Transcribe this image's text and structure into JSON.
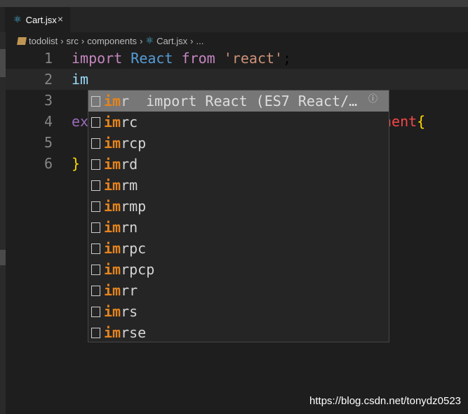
{
  "tab": {
    "label": "Cart.jsx",
    "close": "×",
    "icon": "react-icon"
  },
  "breadcrumb": [
    "todolist",
    "src",
    "components",
    "Cart.jsx",
    "..."
  ],
  "breadcrumb_sep": "›",
  "lines": [
    {
      "n": "1",
      "tokens": [
        [
          "kw",
          "import"
        ],
        [
          "",
          " "
        ],
        [
          "id",
          "React"
        ],
        [
          "",
          " "
        ],
        [
          "kw",
          "from"
        ],
        [
          "",
          " "
        ],
        [
          "str",
          "'react'"
        ],
        [
          "",
          ";"
        ]
      ]
    },
    {
      "n": "2",
      "tokens": [
        [
          "typed",
          "im"
        ]
      ]
    },
    {
      "n": "3",
      "tokens": []
    },
    {
      "n": "4",
      "tokens": [
        [
          "kw2",
          "ex"
        ]
      ],
      "tail": "nent",
      "tail_brace": "{"
    },
    {
      "n": "5",
      "tokens": []
    },
    {
      "n": "6",
      "tokens": [
        [
          "brace",
          "}"
        ]
      ]
    }
  ],
  "suggest": {
    "typed": "im",
    "items": [
      "imr",
      "imrc",
      "imrcp",
      "imrd",
      "imrm",
      "imrmp",
      "imrn",
      "imrpc",
      "imrpcp",
      "imrr",
      "imrs",
      "imrse"
    ],
    "selected_detail": "import React (ES7 React/…",
    "info_icon": "ⓘ"
  },
  "watermark": "https://blog.csdn.net/tonydz0523"
}
